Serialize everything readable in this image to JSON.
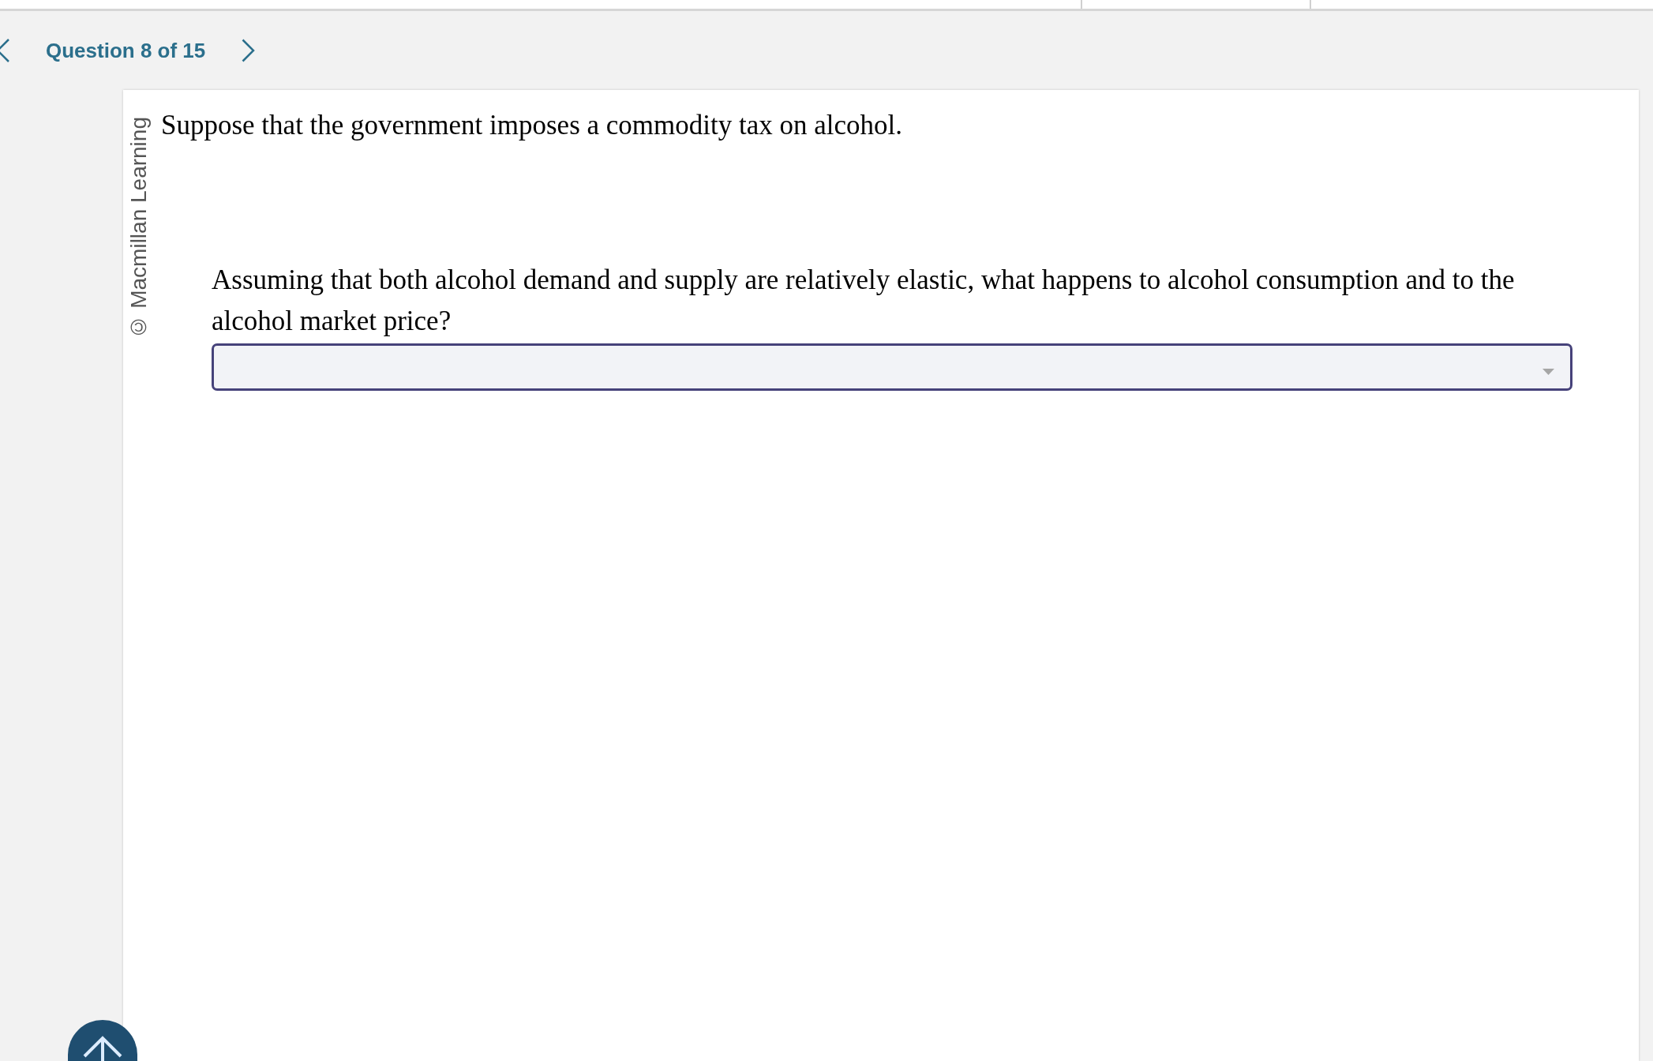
{
  "nav": {
    "question_label": "Question 8 of 15"
  },
  "copyright": "© Macmillan Learning",
  "question": {
    "intro": "Suppose that the government imposes a commodity tax on alcohol.",
    "prompt": "Assuming that both alcohol demand and supply are relatively elastic, what happens to alcohol consumption and to the alcohol market price?"
  }
}
